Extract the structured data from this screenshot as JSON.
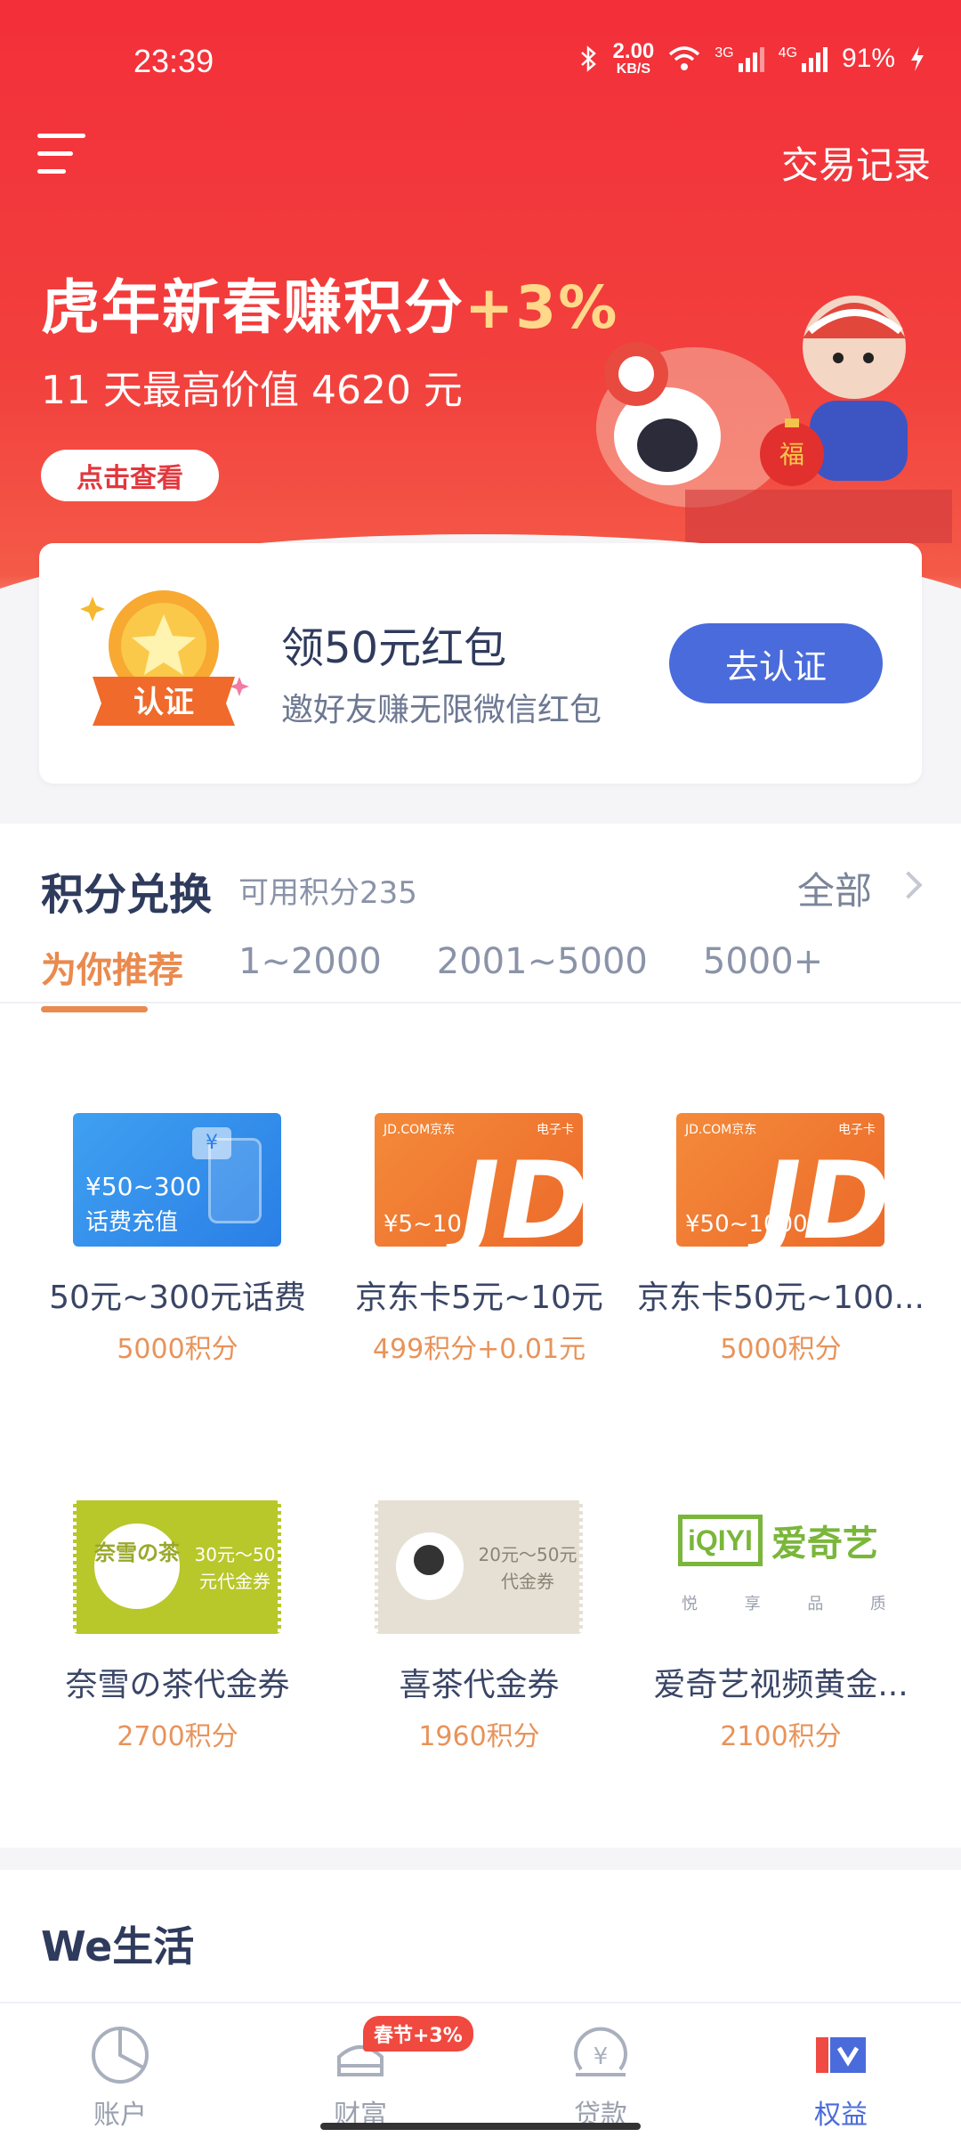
{
  "status_bar": {
    "time": "23:39",
    "net_speed": "2.00",
    "net_unit": "KB/S",
    "sim1": "3G",
    "sim2": "4G",
    "battery": "91%"
  },
  "header": {
    "transaction_record": "交易记录"
  },
  "promo": {
    "title": "虎年新春赚积分",
    "title_plus": "+3%",
    "subtitle": "11 天最高价值 4620 元",
    "button": "点击查看"
  },
  "cert_card": {
    "badge_text": "认证",
    "title": "领50元红包",
    "subtitle": "邀好友赚无限微信红包",
    "button": "去认证"
  },
  "points": {
    "title": "积分兑换",
    "available": "可用积分235",
    "all": "全部",
    "tabs": [
      "为你推荐",
      "1~2000",
      "2001~5000",
      "5000+"
    ],
    "items": [
      {
        "name": "50元~300元话费",
        "price": "5000积分",
        "card_amount": "¥50~300",
        "card_label": "话费充值"
      },
      {
        "name": "京东卡5元~10元",
        "price": "499积分+0.01元",
        "card_brand": "JD.COM京东",
        "card_tag": "电子卡",
        "card_amount": "¥5~10"
      },
      {
        "name": "京东卡50元~100...",
        "price": "5000积分",
        "card_brand": "JD.COM京东",
        "card_tag": "电子卡",
        "card_amount": "¥50~1000"
      },
      {
        "name": "奈雪の茶代金券",
        "price": "2700积分",
        "card_logo": "奈雪の茶",
        "card_text": "30元～50元代金券"
      },
      {
        "name": "喜茶代金券",
        "price": "1960积分",
        "card_text": "20元～50元代金券"
      },
      {
        "name": "爱奇艺视频黄金...",
        "price": "2100积分",
        "card_logo": "iQIYI",
        "card_cn": "爱奇艺",
        "card_slogan": [
          "悦",
          "享",
          "品",
          "质"
        ]
      }
    ]
  },
  "we_life": {
    "title": "We生活"
  },
  "bottom_nav": {
    "items": [
      {
        "label": "账户"
      },
      {
        "label": "财富",
        "badge": "春节+3%"
      },
      {
        "label": "贷款"
      },
      {
        "label": "权益"
      }
    ]
  },
  "colors": {
    "accent": "#4a6bdb",
    "hero_red": "#f32f3a",
    "points_orange": "#e8935a"
  }
}
